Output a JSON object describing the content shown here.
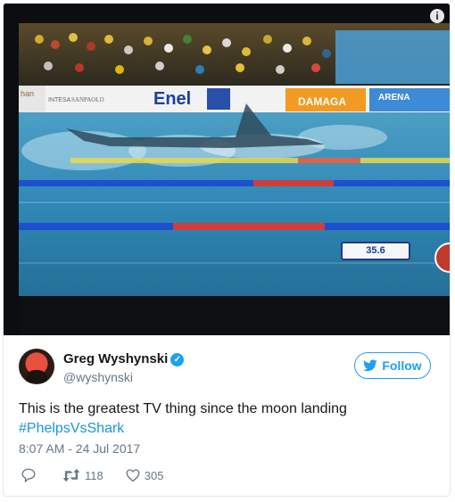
{
  "media": {
    "timer": "35.6",
    "sponsors": [
      "han",
      "INTESA",
      "SANPAOLO",
      "Enel",
      "DAMAGA",
      "ARENA"
    ],
    "info_label": "i"
  },
  "author": {
    "name": "Greg Wyshynski",
    "handle": "@wyshynski",
    "verified": true
  },
  "follow_label": "Follow",
  "tweet": {
    "text": "This is the greatest TV thing since the moon landing",
    "hashtag": "#PhelpsVsShark"
  },
  "timestamp": "8:07 AM - 24 Jul 2017",
  "stats": {
    "replies": "",
    "retweets": "118",
    "likes": "305"
  },
  "colors": {
    "accent": "#1da1f2",
    "link": "#1b95e0",
    "muted": "#657786"
  }
}
